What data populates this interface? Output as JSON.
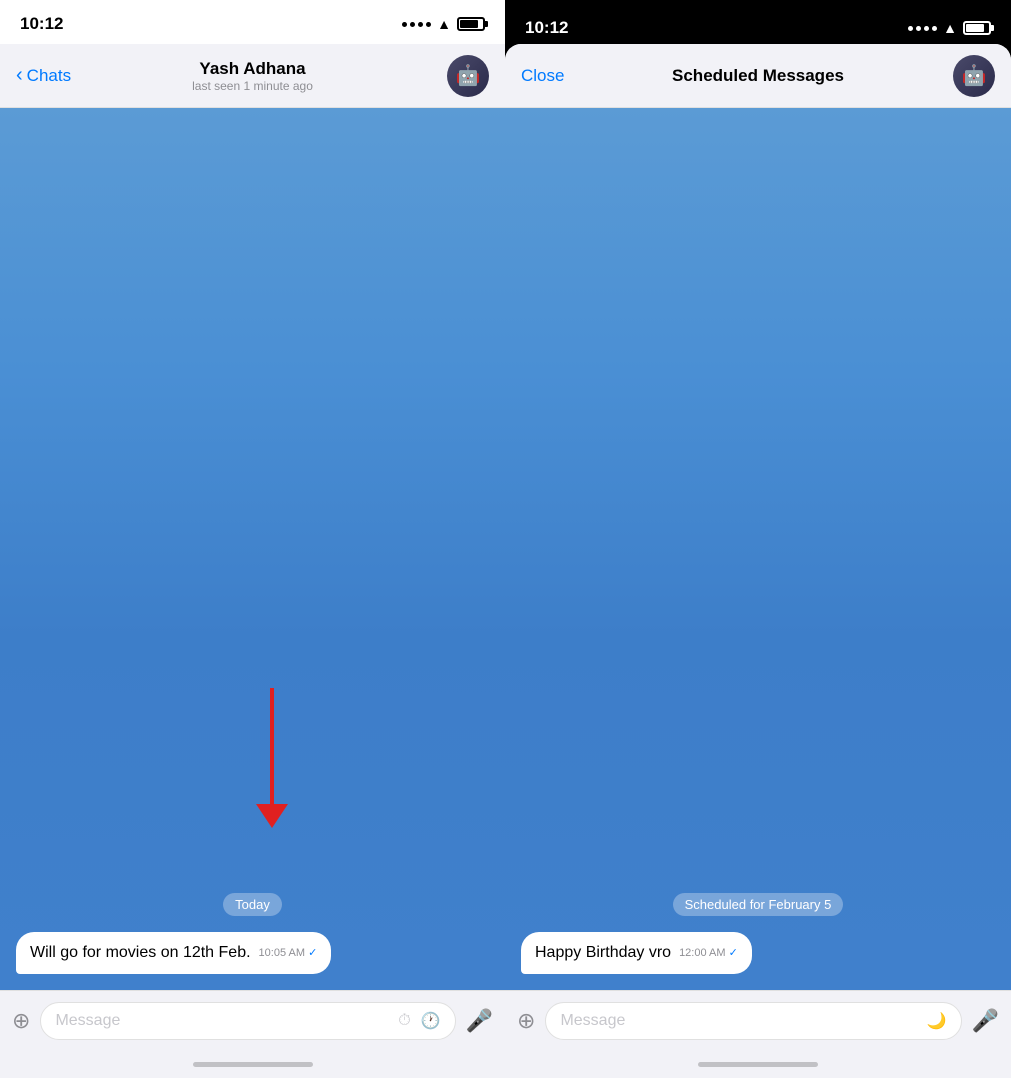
{
  "left": {
    "status_bar": {
      "time": "10:12"
    },
    "nav": {
      "back_label": "Chats",
      "contact_name": "Yash Adhana",
      "last_seen": "last seen 1 minute ago",
      "avatar_emoji": "🤖"
    },
    "chat": {
      "date_badge": "Today",
      "message_text": "Will go for movies on 12th Feb.",
      "message_time": "10:05 AM",
      "message_input_placeholder": "Message"
    }
  },
  "right": {
    "status_bar": {
      "time": "10:12"
    },
    "nav": {
      "close_label": "Close",
      "title": "Scheduled Messages",
      "avatar_emoji": "🤖"
    },
    "chat": {
      "scheduled_badge": "Scheduled for February 5",
      "message_text": "Happy Birthday vro",
      "message_time": "12:00 AM",
      "message_input_placeholder": "Message"
    }
  },
  "icons": {
    "attachment": "📎",
    "schedule": "⏱",
    "clock": "🕐",
    "mic": "🎤",
    "moon": "🌙"
  }
}
